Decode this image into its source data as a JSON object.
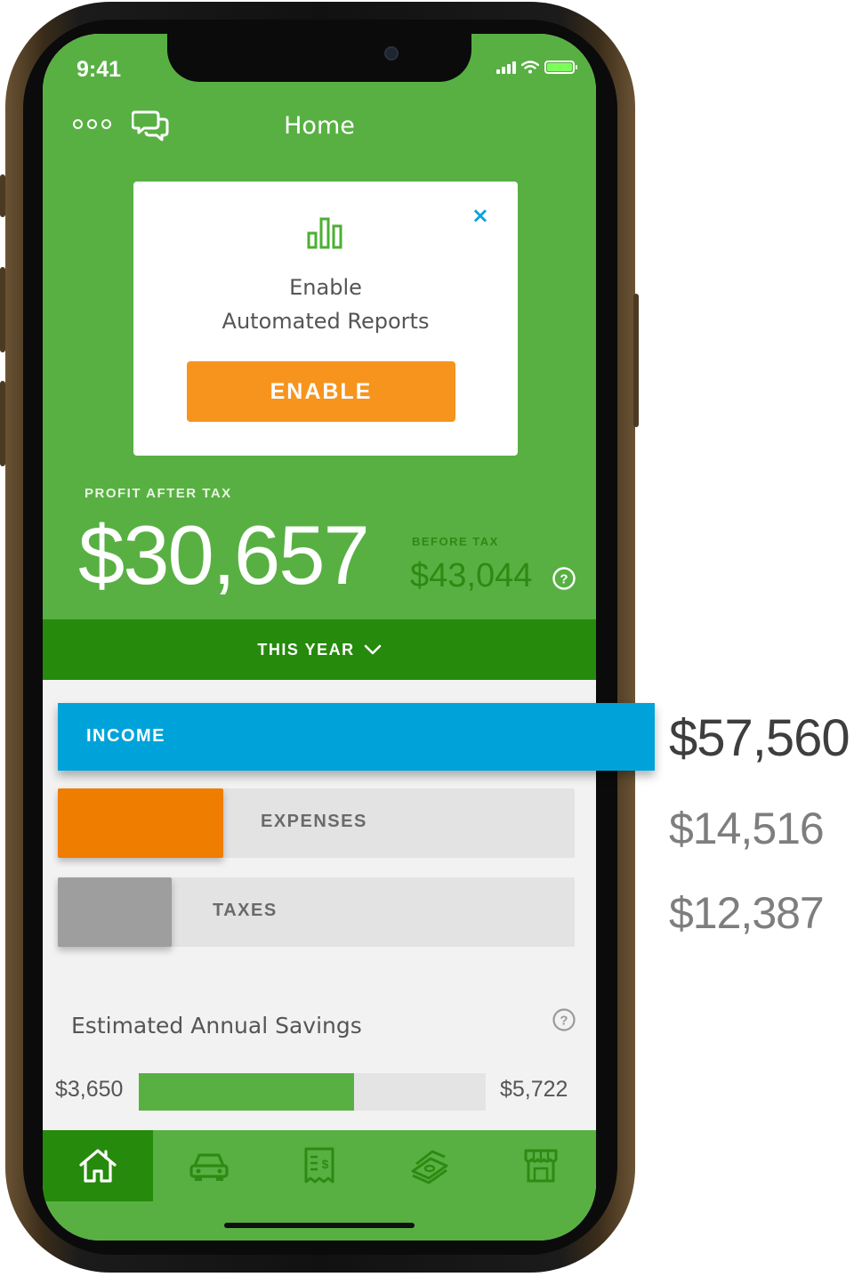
{
  "status_bar": {
    "time": "9:41"
  },
  "nav": {
    "title": "Home"
  },
  "card": {
    "line1": "Enable",
    "line2": "Automated Reports",
    "button_label": "ENABLE",
    "close_symbol": "×"
  },
  "profit": {
    "label": "PROFIT AFTER TAX",
    "value": "$30,657",
    "before_label": "BEFORE TAX",
    "before_value": "$43,044"
  },
  "period": {
    "label": "THIS YEAR"
  },
  "breakdown": {
    "income": {
      "label": "INCOME",
      "amount": "$57,560",
      "fraction": 1.0,
      "color": "#00a3d9"
    },
    "expenses": {
      "label": "EXPENSES",
      "amount": "$14,516",
      "fraction": 0.32,
      "color": "#ee7d00"
    },
    "taxes": {
      "label": "TAXES",
      "amount": "$12,387",
      "fraction": 0.22,
      "color": "#9e9e9e"
    }
  },
  "savings": {
    "title": "Estimated Annual Savings",
    "min": "$3,650",
    "max": "$5,722",
    "fill_fraction": 0.62
  },
  "tabs": [
    {
      "icon": "home-icon",
      "active": true
    },
    {
      "icon": "car-icon",
      "active": false
    },
    {
      "icon": "receipt-icon",
      "active": false
    },
    {
      "icon": "money-stack-icon",
      "active": false
    },
    {
      "icon": "shop-icon",
      "active": false
    }
  ],
  "colors": {
    "brand_green": "#58b043",
    "dark_green": "#268a0c",
    "accent_orange": "#f7941d",
    "income_blue": "#00a3d9"
  }
}
